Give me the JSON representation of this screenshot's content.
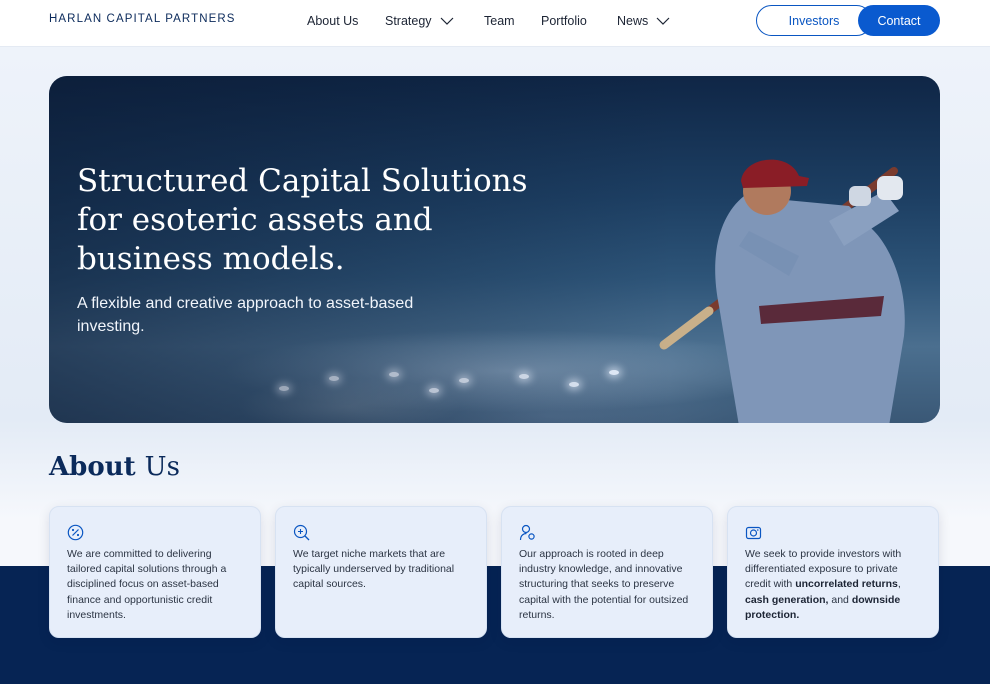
{
  "header": {
    "logo": "HARLAN CAPITAL PARTNERS",
    "nav": [
      {
        "label": "About Us",
        "dropdown": false
      },
      {
        "label": "Strategy",
        "dropdown": true
      },
      {
        "label": "Team",
        "dropdown": false
      },
      {
        "label": "Portfolio",
        "dropdown": false
      },
      {
        "label": "News",
        "dropdown": true
      }
    ],
    "investors_label": "Investors",
    "contact_label": "Contact"
  },
  "hero": {
    "title": "Structured Capital Solutions for esoteric assets and business models.",
    "subtitle": "A flexible and creative approach to asset-based investing."
  },
  "about": {
    "title_first": "About",
    "title_second": "Us",
    "cards": [
      {
        "icon": "percent-icon",
        "text": "We are committed to delivering tailored capital solutions through a disciplined focus on asset-based finance and opportunistic credit investments."
      },
      {
        "icon": "magnifier-plus-icon",
        "text": "We target niche markets  that are typically underserved by traditional capital sources."
      },
      {
        "icon": "person-settings-icon",
        "text": "Our approach is rooted in deep industry knowledge, and innovative structuring that seeks to preserve capital with the potential for outsized returns."
      },
      {
        "icon": "camera-icon",
        "text_pre": "We seek to provide investors with differentiated exposure to private credit with ",
        "bold1": "uncorrelated returns",
        "text_mid1": ", ",
        "bold2": "cash generation,",
        "text_mid2": " and ",
        "bold3": "downside protection."
      }
    ]
  },
  "colors": {
    "brand_navy": "#0b2a5b",
    "accent_blue": "#0a5acf",
    "footer_navy": "#062454"
  }
}
